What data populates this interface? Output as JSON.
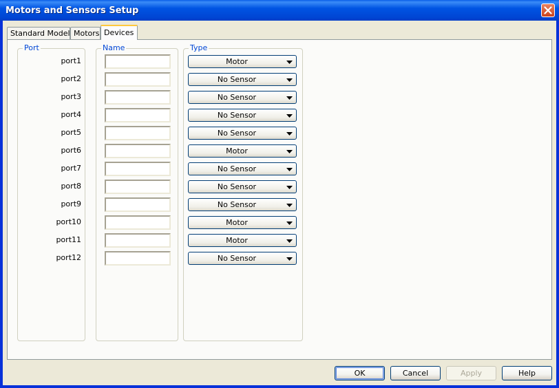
{
  "window": {
    "title": "Motors and Sensors Setup"
  },
  "tabs": [
    {
      "label": "Standard Models"
    },
    {
      "label": "Motors"
    },
    {
      "label": "Devices"
    }
  ],
  "groups": {
    "port": "Port",
    "name": "Name",
    "type": "Type"
  },
  "ports": [
    {
      "port": "port1",
      "name": "",
      "type": "Motor"
    },
    {
      "port": "port2",
      "name": "",
      "type": "No Sensor"
    },
    {
      "port": "port3",
      "name": "",
      "type": "No Sensor"
    },
    {
      "port": "port4",
      "name": "",
      "type": "No Sensor"
    },
    {
      "port": "port5",
      "name": "",
      "type": "No Sensor"
    },
    {
      "port": "port6",
      "name": "",
      "type": "Motor"
    },
    {
      "port": "port7",
      "name": "",
      "type": "No Sensor"
    },
    {
      "port": "port8",
      "name": "",
      "type": "No Sensor"
    },
    {
      "port": "port9",
      "name": "",
      "type": "No Sensor"
    },
    {
      "port": "port10",
      "name": "",
      "type": "Motor"
    },
    {
      "port": "port11",
      "name": "",
      "type": "Motor"
    },
    {
      "port": "port12",
      "name": "",
      "type": "No Sensor"
    }
  ],
  "buttons": {
    "ok": "OK",
    "cancel": "Cancel",
    "apply": "Apply",
    "help": "Help"
  },
  "colors": {
    "titlebar": "#0054e3",
    "legend": "#0046d5",
    "active_tab_highlight": "#ffc83c"
  }
}
